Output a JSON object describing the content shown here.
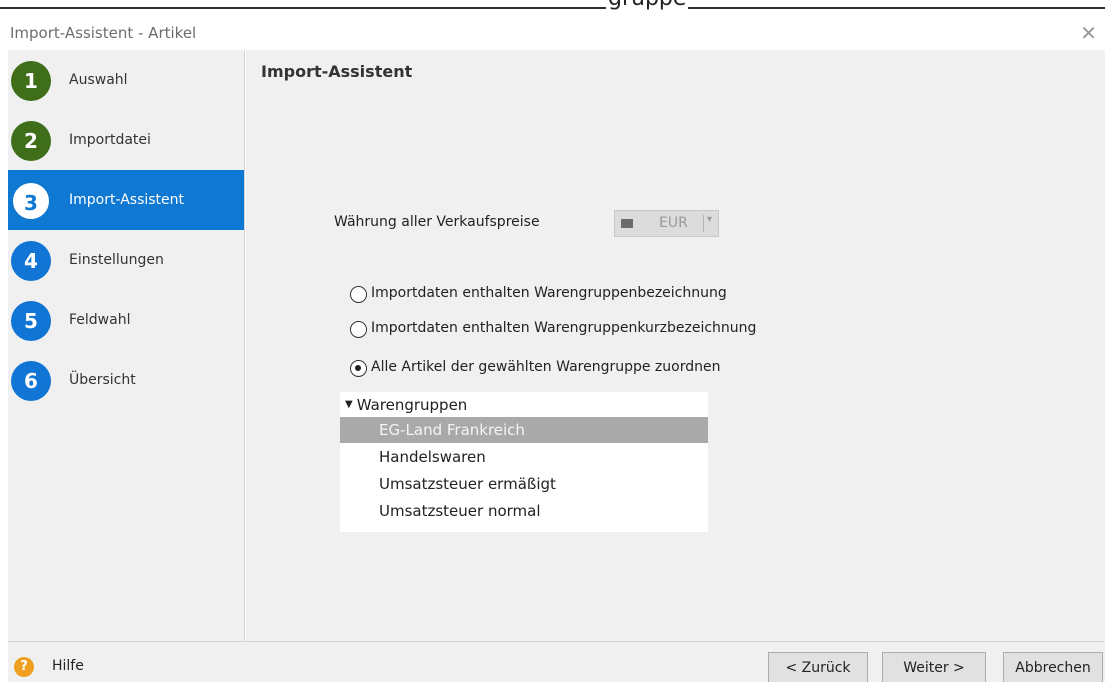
{
  "top_strip": {
    "cut_text": "gruppe"
  },
  "window": {
    "title": "Import-Assistent - Artikel",
    "close_glyph": "✕"
  },
  "steps": [
    {
      "number": "1",
      "label": "Auswahl",
      "state": "done"
    },
    {
      "number": "2",
      "label": "Importdatei",
      "state": "done"
    },
    {
      "number": "3",
      "label": "Import-Assistent",
      "state": "active"
    },
    {
      "number": "4",
      "label": "Einstellungen",
      "state": "todo"
    },
    {
      "number": "5",
      "label": "Feldwahl",
      "state": "todo"
    },
    {
      "number": "6",
      "label": "Übersicht",
      "state": "todo"
    }
  ],
  "main": {
    "heading": "Import-Assistent",
    "currency_label": "Währung aller Verkaufspreise",
    "currency_value": "EUR",
    "radios": [
      {
        "label": "Importdaten enthalten Warengruppenbezeichnung",
        "checked": false
      },
      {
        "label": "Importdaten enthalten Warengruppenkurzbezeichnung",
        "checked": false
      },
      {
        "label": "Alle Artikel der gewählten Warengruppe zuordnen",
        "checked": true
      }
    ],
    "tree": {
      "root": "Warengruppen",
      "items": [
        {
          "label": "EG-Land Frankreich",
          "selected": true
        },
        {
          "label": "Handelswaren",
          "selected": false
        },
        {
          "label": "Umsatzsteuer ermäßigt",
          "selected": false
        },
        {
          "label": "Umsatzsteuer normal",
          "selected": false
        }
      ]
    }
  },
  "footer": {
    "help_icon": "?",
    "help_label": "Hilfe",
    "back_label": "< Zurück",
    "next_label": "Weiter >",
    "cancel_label": "Abbrechen"
  },
  "colors": {
    "step_done": "#3f6e1a",
    "step_todo": "#1075d4",
    "step_active_bg": "#0f78d2",
    "tree_selected": "#a9a9a9",
    "help_icon": "#f0a020"
  }
}
